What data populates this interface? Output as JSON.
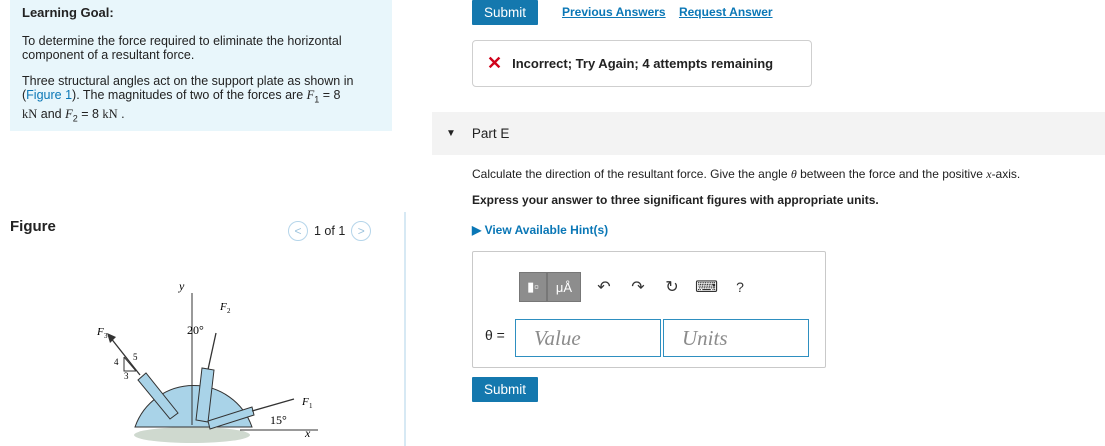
{
  "goal": {
    "heading": "Learning Goal:",
    "para1": "To determine the force required to eliminate the horizontal component of a resultant force.",
    "para2_a": "Three structural angles act on the support plate as shown in (",
    "para2_link": "Figure 1",
    "para2_b": "). The magnitudes of two of the forces are ",
    "f1_symbol": "F",
    "f1_sub": "1",
    "f1_eq": " = 8",
    "unit_kn": "kN",
    "and": " and ",
    "f2_symbol": "F",
    "f2_sub": "2",
    "f2_eq": " = 8 ",
    "unit_kn2": "kN",
    "period": " ."
  },
  "figure": {
    "title": "Figure",
    "pager_text": "1 of 1",
    "prev_icon": "<",
    "next_icon": ">",
    "labels": {
      "y": "y",
      "x": "x",
      "f1": "F",
      "f1_sub": "1",
      "f2": "F",
      "f2_sub": "2",
      "f3": "F",
      "f3_sub": "3",
      "angle_20": "20°",
      "angle_15": "15°",
      "tri_4": "4",
      "tri_3": "3",
      "tri_5": "5"
    }
  },
  "header": {
    "submit_label": "Submit",
    "prev_answers": "Previous Answers",
    "request_answer": "Request Answer"
  },
  "feedback": {
    "icon": "✕",
    "text": "Incorrect; Try Again; 4 attempts remaining"
  },
  "part": {
    "label": "Part E",
    "question_a": "Calculate the direction of the resultant force. Give the angle ",
    "theta": "θ",
    "question_b": " between the force and the positive ",
    "x_var": "x",
    "question_c": "-axis.",
    "instruction": "Express your answer to three significant figures with appropriate units.",
    "hints_label": "View Available Hint(s)"
  },
  "answer": {
    "theta_label": "θ =",
    "value_placeholder": "Value",
    "units_placeholder": "Units",
    "submit_label": "Submit",
    "toolbar": {
      "template_icon": "▮▫",
      "mu_label": "μÅ",
      "undo": "↶",
      "redo": "↷",
      "reset": "↻",
      "keyboard": "⌨",
      "help": "?"
    }
  }
}
